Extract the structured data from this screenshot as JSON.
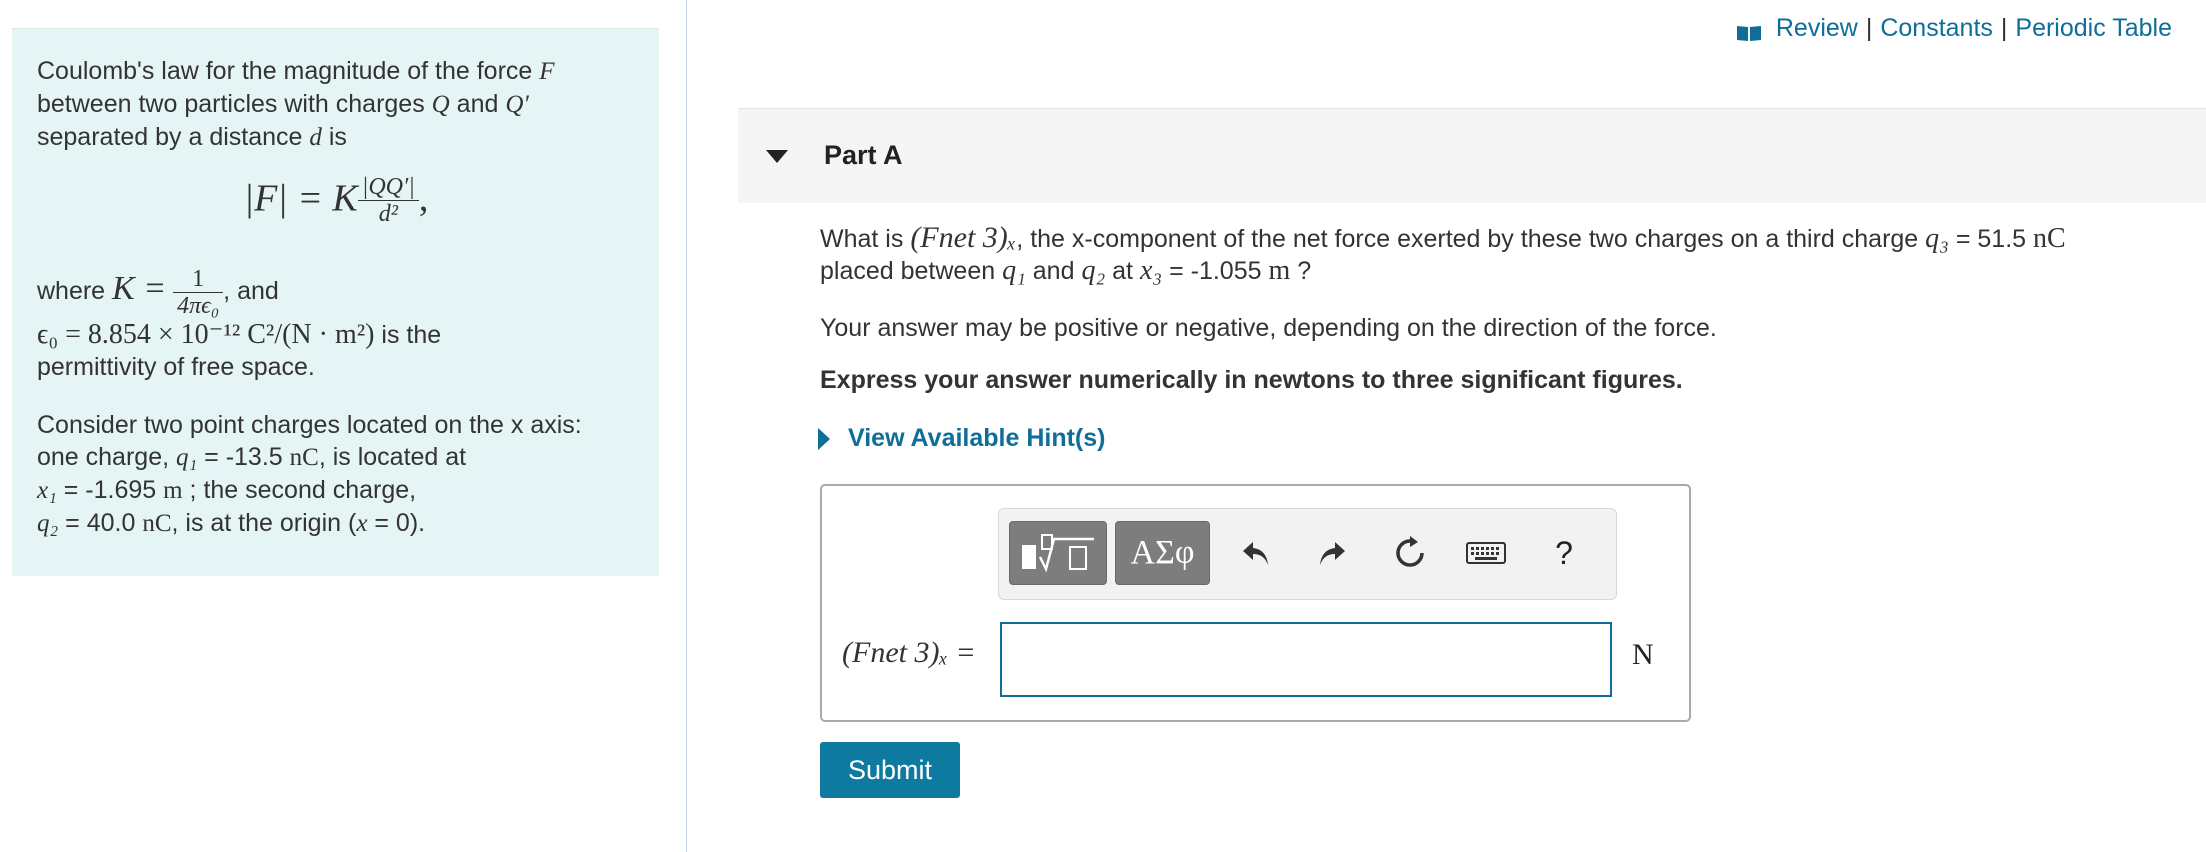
{
  "header": {
    "links": [
      "Review",
      "Constants",
      "Periodic Table"
    ],
    "separator": "|",
    "icon": "book-icon",
    "accent": "#0e6e98"
  },
  "intro": {
    "line1": "Coulomb's law for the magnitude of the force",
    "var_F": "F",
    "line2": "between two particles with charges",
    "var_Q": "Q",
    "and": "and",
    "var_Qp": "Q′",
    "line3": "separated by a distance",
    "var_d": "d",
    "is": "is",
    "formula_lhs": "|F| = K",
    "formula_num": "|QQ′|",
    "formula_den": "d²",
    "where": "where",
    "K_def": "K =",
    "K_num": "1",
    "K_den": "4πϵ₀",
    "and2": ", and",
    "eps_def": "ϵ₀ = 8.854 × 10⁻¹² C²/(N · m²)",
    "is_the": "is the",
    "permittivity": "permittivity of free space.",
    "consider1": "Consider two point charges located on the x axis:",
    "consider2a": "one charge,",
    "q1": "q₁",
    "q1_val": "= -13.5",
    "nC": "nC",
    "consider2b": ", is located at",
    "x1": "x₁",
    "x1_val": "= -1.695",
    "m": "m",
    "consider3b": "; the second charge,",
    "q2": "q₂",
    "q2_val": "= 40.0",
    "consider4b": ", is at the origin (",
    "x_eq": "x",
    "origin_end": "= 0)."
  },
  "part": {
    "title": "Part A",
    "question_a": "What is",
    "F_net3": "(Fnet 3)ₓ",
    "question_b": ", the x-component of the net force exerted by these two charges on a third charge",
    "q3": "q₃",
    "q3_val": "= 51.5",
    "nC": "nC",
    "question_c": "placed between",
    "q1": "q₁",
    "and": "and",
    "q2": "q₂",
    "at": "at",
    "x3": "x₃",
    "x3_val": "= -1.055",
    "m": "m",
    "qmark": "?",
    "note": "Your answer may be positive or negative, depending on the direction of the force.",
    "express": "Express your answer numerically in newtons to three significant figures.",
    "hint": "View Available Hint(s)"
  },
  "toolbar": {
    "greek_label": "ΑΣφ",
    "help_label": "?"
  },
  "answer": {
    "label": "(Fnet 3)ₓ =",
    "value": "",
    "unit": "N"
  },
  "submit_label": "Submit"
}
